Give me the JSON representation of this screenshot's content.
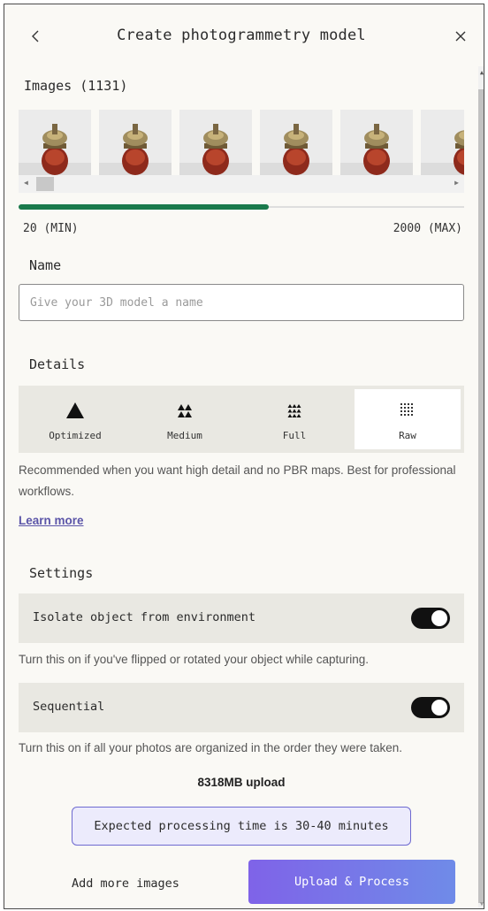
{
  "header": {
    "title": "Create photogrammetry model",
    "back_icon": "chevron-left-icon",
    "close_icon": "close-icon"
  },
  "images": {
    "label": "Images (1131)",
    "visible_thumbnails": 6,
    "range": {
      "min_label": "20 (MIN)",
      "max_label": "2000 (MAX)",
      "value": 1131,
      "min": 20,
      "max": 2000
    },
    "accent_color": "#1a7a4c"
  },
  "name": {
    "label": "Name",
    "placeholder": "Give your 3D model a name",
    "value": ""
  },
  "details": {
    "label": "Details",
    "options": [
      {
        "label": "Optimized",
        "icon": "triangle-single-icon",
        "selected": false
      },
      {
        "label": "Medium",
        "icon": "triangle-grid-2x2-icon",
        "selected": false
      },
      {
        "label": "Full",
        "icon": "triangle-grid-3x3-icon",
        "selected": false
      },
      {
        "label": "Raw",
        "icon": "dot-grid-icon",
        "selected": true
      }
    ],
    "description": "Recommended when you want high detail and no PBR maps. Best for professional workflows.",
    "learn_more": "Learn more"
  },
  "settings": {
    "label": "Settings",
    "isolate": {
      "label": "Isolate object from environment",
      "enabled": true,
      "help": "Turn this on if you've flipped or rotated your object while capturing."
    },
    "sequential": {
      "label": "Sequential",
      "enabled": true,
      "help": "Turn this on if all your photos are organized in the order they were taken."
    }
  },
  "footer": {
    "upload_size": "8318MB upload",
    "notice": "Expected processing time is 30-40 minutes",
    "add_more": "Add more images",
    "upload_button": "Upload & Process"
  }
}
